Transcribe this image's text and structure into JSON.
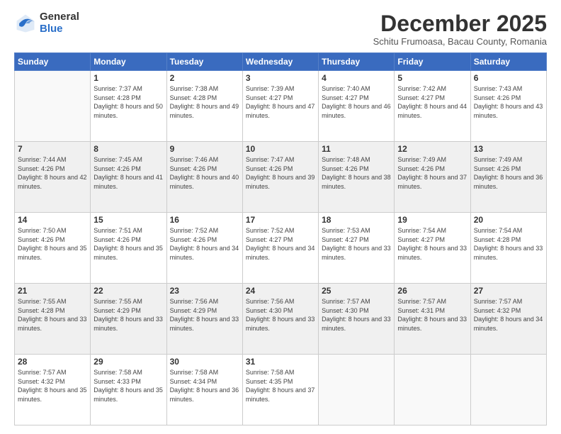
{
  "logo": {
    "general": "General",
    "blue": "Blue"
  },
  "title": "December 2025",
  "subtitle": "Schitu Frumoasa, Bacau County, Romania",
  "weekdays": [
    "Sunday",
    "Monday",
    "Tuesday",
    "Wednesday",
    "Thursday",
    "Friday",
    "Saturday"
  ],
  "weeks": [
    [
      {
        "day": "",
        "sunrise": "",
        "sunset": "",
        "daylight": ""
      },
      {
        "day": "1",
        "sunrise": "Sunrise: 7:37 AM",
        "sunset": "Sunset: 4:28 PM",
        "daylight": "Daylight: 8 hours and 50 minutes."
      },
      {
        "day": "2",
        "sunrise": "Sunrise: 7:38 AM",
        "sunset": "Sunset: 4:28 PM",
        "daylight": "Daylight: 8 hours and 49 minutes."
      },
      {
        "day": "3",
        "sunrise": "Sunrise: 7:39 AM",
        "sunset": "Sunset: 4:27 PM",
        "daylight": "Daylight: 8 hours and 47 minutes."
      },
      {
        "day": "4",
        "sunrise": "Sunrise: 7:40 AM",
        "sunset": "Sunset: 4:27 PM",
        "daylight": "Daylight: 8 hours and 46 minutes."
      },
      {
        "day": "5",
        "sunrise": "Sunrise: 7:42 AM",
        "sunset": "Sunset: 4:27 PM",
        "daylight": "Daylight: 8 hours and 44 minutes."
      },
      {
        "day": "6",
        "sunrise": "Sunrise: 7:43 AM",
        "sunset": "Sunset: 4:26 PM",
        "daylight": "Daylight: 8 hours and 43 minutes."
      }
    ],
    [
      {
        "day": "7",
        "sunrise": "Sunrise: 7:44 AM",
        "sunset": "Sunset: 4:26 PM",
        "daylight": "Daylight: 8 hours and 42 minutes."
      },
      {
        "day": "8",
        "sunrise": "Sunrise: 7:45 AM",
        "sunset": "Sunset: 4:26 PM",
        "daylight": "Daylight: 8 hours and 41 minutes."
      },
      {
        "day": "9",
        "sunrise": "Sunrise: 7:46 AM",
        "sunset": "Sunset: 4:26 PM",
        "daylight": "Daylight: 8 hours and 40 minutes."
      },
      {
        "day": "10",
        "sunrise": "Sunrise: 7:47 AM",
        "sunset": "Sunset: 4:26 PM",
        "daylight": "Daylight: 8 hours and 39 minutes."
      },
      {
        "day": "11",
        "sunrise": "Sunrise: 7:48 AM",
        "sunset": "Sunset: 4:26 PM",
        "daylight": "Daylight: 8 hours and 38 minutes."
      },
      {
        "day": "12",
        "sunrise": "Sunrise: 7:49 AM",
        "sunset": "Sunset: 4:26 PM",
        "daylight": "Daylight: 8 hours and 37 minutes."
      },
      {
        "day": "13",
        "sunrise": "Sunrise: 7:49 AM",
        "sunset": "Sunset: 4:26 PM",
        "daylight": "Daylight: 8 hours and 36 minutes."
      }
    ],
    [
      {
        "day": "14",
        "sunrise": "Sunrise: 7:50 AM",
        "sunset": "Sunset: 4:26 PM",
        "daylight": "Daylight: 8 hours and 35 minutes."
      },
      {
        "day": "15",
        "sunrise": "Sunrise: 7:51 AM",
        "sunset": "Sunset: 4:26 PM",
        "daylight": "Daylight: 8 hours and 35 minutes."
      },
      {
        "day": "16",
        "sunrise": "Sunrise: 7:52 AM",
        "sunset": "Sunset: 4:26 PM",
        "daylight": "Daylight: 8 hours and 34 minutes."
      },
      {
        "day": "17",
        "sunrise": "Sunrise: 7:52 AM",
        "sunset": "Sunset: 4:27 PM",
        "daylight": "Daylight: 8 hours and 34 minutes."
      },
      {
        "day": "18",
        "sunrise": "Sunrise: 7:53 AM",
        "sunset": "Sunset: 4:27 PM",
        "daylight": "Daylight: 8 hours and 33 minutes."
      },
      {
        "day": "19",
        "sunrise": "Sunrise: 7:54 AM",
        "sunset": "Sunset: 4:27 PM",
        "daylight": "Daylight: 8 hours and 33 minutes."
      },
      {
        "day": "20",
        "sunrise": "Sunrise: 7:54 AM",
        "sunset": "Sunset: 4:28 PM",
        "daylight": "Daylight: 8 hours and 33 minutes."
      }
    ],
    [
      {
        "day": "21",
        "sunrise": "Sunrise: 7:55 AM",
        "sunset": "Sunset: 4:28 PM",
        "daylight": "Daylight: 8 hours and 33 minutes."
      },
      {
        "day": "22",
        "sunrise": "Sunrise: 7:55 AM",
        "sunset": "Sunset: 4:29 PM",
        "daylight": "Daylight: 8 hours and 33 minutes."
      },
      {
        "day": "23",
        "sunrise": "Sunrise: 7:56 AM",
        "sunset": "Sunset: 4:29 PM",
        "daylight": "Daylight: 8 hours and 33 minutes."
      },
      {
        "day": "24",
        "sunrise": "Sunrise: 7:56 AM",
        "sunset": "Sunset: 4:30 PM",
        "daylight": "Daylight: 8 hours and 33 minutes."
      },
      {
        "day": "25",
        "sunrise": "Sunrise: 7:57 AM",
        "sunset": "Sunset: 4:30 PM",
        "daylight": "Daylight: 8 hours and 33 minutes."
      },
      {
        "day": "26",
        "sunrise": "Sunrise: 7:57 AM",
        "sunset": "Sunset: 4:31 PM",
        "daylight": "Daylight: 8 hours and 33 minutes."
      },
      {
        "day": "27",
        "sunrise": "Sunrise: 7:57 AM",
        "sunset": "Sunset: 4:32 PM",
        "daylight": "Daylight: 8 hours and 34 minutes."
      }
    ],
    [
      {
        "day": "28",
        "sunrise": "Sunrise: 7:57 AM",
        "sunset": "Sunset: 4:32 PM",
        "daylight": "Daylight: 8 hours and 35 minutes."
      },
      {
        "day": "29",
        "sunrise": "Sunrise: 7:58 AM",
        "sunset": "Sunset: 4:33 PM",
        "daylight": "Daylight: 8 hours and 35 minutes."
      },
      {
        "day": "30",
        "sunrise": "Sunrise: 7:58 AM",
        "sunset": "Sunset: 4:34 PM",
        "daylight": "Daylight: 8 hours and 36 minutes."
      },
      {
        "day": "31",
        "sunrise": "Sunrise: 7:58 AM",
        "sunset": "Sunset: 4:35 PM",
        "daylight": "Daylight: 8 hours and 37 minutes."
      },
      {
        "day": "",
        "sunrise": "",
        "sunset": "",
        "daylight": ""
      },
      {
        "day": "",
        "sunrise": "",
        "sunset": "",
        "daylight": ""
      },
      {
        "day": "",
        "sunrise": "",
        "sunset": "",
        "daylight": ""
      }
    ]
  ]
}
